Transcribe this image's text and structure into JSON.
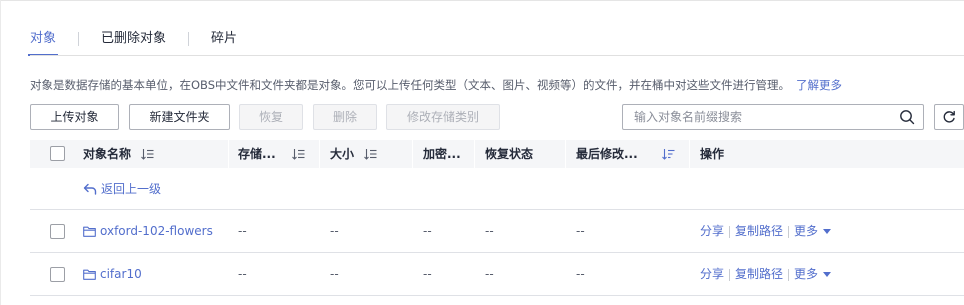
{
  "tabs": [
    {
      "label": "对象",
      "active": true
    },
    {
      "label": "已删除对象",
      "active": false
    },
    {
      "label": "碎片",
      "active": false
    }
  ],
  "description": {
    "text": "对象是数据存储的基本单位，在OBS中文件和文件夹都是对象。您可以上传任何类型（文本、图片、视频等）的文件，并在桶中对这些文件进行管理。",
    "link_label": "了解更多"
  },
  "toolbar": {
    "upload_label": "上传对象",
    "new_folder_label": "新建文件夹",
    "restore_label": "恢复",
    "delete_label": "删除",
    "change_storage_label": "修改存储类别"
  },
  "search": {
    "placeholder": "输入对象名前缀搜索",
    "icon": "search-icon"
  },
  "table": {
    "columns": {
      "name": "对象名称",
      "storage": "存储...",
      "size": "大小",
      "encryption": "加密...",
      "restore_status": "恢复状态",
      "last_modified": "最后修改...",
      "operations": "操作"
    },
    "back_label": "返回上一级",
    "rows": [
      {
        "name": "oxford-102-flowers",
        "storage": "--",
        "size": "--",
        "encryption": "--",
        "restore_status": "--",
        "last_modified": "--",
        "share": "分享",
        "copy_path": "复制路径",
        "more": "更多"
      },
      {
        "name": "cifar10",
        "storage": "--",
        "size": "--",
        "encryption": "--",
        "restore_status": "--",
        "last_modified": "--",
        "share": "分享",
        "copy_path": "复制路径",
        "more": "更多"
      }
    ]
  },
  "colors": {
    "accent": "#526ecc",
    "text": "#252b3a",
    "muted": "#575d6c",
    "header_bg": "#f5f6f8"
  }
}
